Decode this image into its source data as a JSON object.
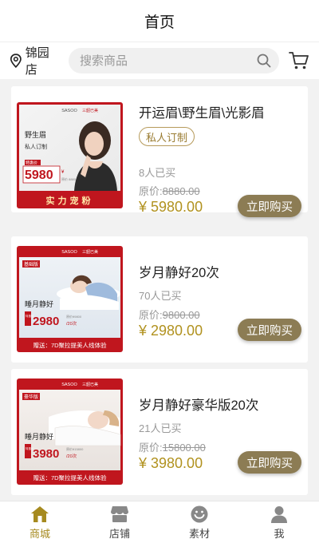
{
  "header": {
    "title": "首页"
  },
  "search": {
    "store_name": "锦园店",
    "placeholder": "搜索商品"
  },
  "products": [
    {
      "name": "开运眉\\野生眉\\光影眉",
      "tag": "私人订制",
      "sold": "8人已买",
      "orig_label": "原价:",
      "orig_value": "8880.00",
      "price": "¥ 5980.00",
      "buy_label": "立即购买",
      "poster": {
        "brand": "SASOO",
        "brand_sub": "三韶肌秀",
        "brand_right": "三韶已美",
        "title": "野生眉",
        "sub": "私人订制",
        "badge": "特惠价",
        "big_price": "5980",
        "unit": "¥",
        "orig_small": "原价 8880",
        "banner": "实力宠粉"
      }
    },
    {
      "name": "岁月静好20次",
      "tag": "",
      "sold": "70人已买",
      "orig_label": "原价:",
      "orig_value": "9800.00",
      "price": "¥ 2980.00",
      "buy_label": "立即购买",
      "poster": {
        "brand": "SASOO",
        "brand_sub": "三韶肌秀",
        "brand_right": "三韶已美",
        "corner": "基础版",
        "title": "睡月静好",
        "badge": "特惠价",
        "big_price": "2980",
        "orig_small": "原价¥9800",
        "per": "/20次",
        "banner": "赠送：7D聚拉提美人线体验"
      }
    },
    {
      "name": "岁月静好豪华版20次",
      "tag": "",
      "sold": "21人已买",
      "orig_label": "原价:",
      "orig_value": "15800.00",
      "price": "¥ 3980.00",
      "buy_label": "立即购买",
      "poster": {
        "brand": "SASOO",
        "brand_sub": "三韶肌秀",
        "brand_right": "三韶已美",
        "corner": "豪华版",
        "title": "睡月静好",
        "badge": "特惠价",
        "big_price": "3980",
        "orig_small": "原价¥15800",
        "per": "/20次",
        "banner": "赠送：7D聚拉提美人线体验"
      }
    }
  ],
  "tabs": [
    {
      "label": "商城",
      "icon": "home-icon",
      "active": true
    },
    {
      "label": "店铺",
      "icon": "shop-icon",
      "active": false
    },
    {
      "label": "素材",
      "icon": "material-icon",
      "active": false
    },
    {
      "label": "我",
      "icon": "user-icon",
      "active": false
    }
  ],
  "colors": {
    "accent": "#a68a1f",
    "price": "#b1921f",
    "buy_button": "#8c7c54",
    "poster_red": "#c0161e"
  }
}
